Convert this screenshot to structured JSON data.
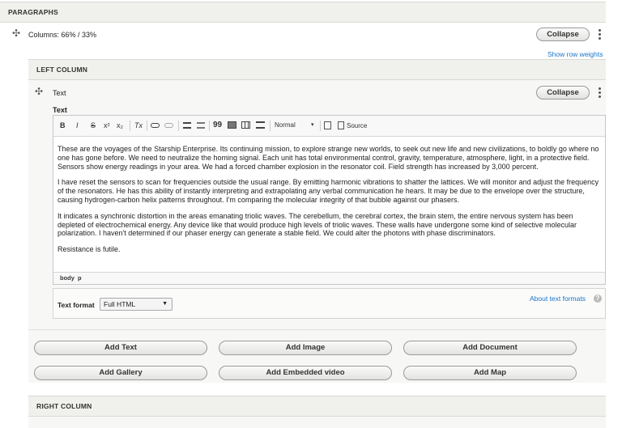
{
  "paragraphs_header": "PARAGRAPHS",
  "columns_row": {
    "label": "Columns: 66% / 33%",
    "collapse_label": "Collapse",
    "show_row_weights": "Show row weights"
  },
  "left_column": {
    "header": "LEFT COLUMN",
    "text_item": {
      "label": "Text",
      "collapse_label": "Collapse",
      "field_label": "Text"
    }
  },
  "toolbar": {
    "bold": "B",
    "italic": "I",
    "strike": "S",
    "superscript": "x²",
    "subscript": "x₂",
    "remove_format": "Tx",
    "blockquote": "99",
    "format_value": "Normal",
    "source": "Source"
  },
  "editor": {
    "paragraphs": [
      "These are the voyages of the Starship Enterprise. Its continuing mission, to explore strange new worlds, to seek out new life and new civilizations, to boldly go where no one has gone before. We need to neutralize the homing signal. Each unit has total environmental control, gravity, temperature, atmosphere, light, in a protective field. Sensors show energy readings in your area. We had a forced chamber explosion in the resonator coil. Field strength has increased by 3,000 percent.",
      "I have reset the sensors to scan for frequencies outside the usual range. By emitting harmonic vibrations to shatter the lattices. We will monitor and adjust the frequency of the resonators. He has this ability of instantly interpreting and extrapolating any verbal communication he hears. It may be due to the envelope over the structure, causing hydrogen-carbon helix patterns throughout. I'm comparing the molecular integrity of that bubble against our phasers.",
      "It indicates a synchronic distortion in the areas emanating triolic waves. The cerebellum, the cerebral cortex, the brain stem,  the entire nervous system has been depleted of electrochemical energy. Any device like that would produce high levels of triolic waves. These walls have undergone some kind of selective molecular polarization. I haven't determined if our phaser energy can generate a stable field. We could alter the photons with phase discriminators.",
      "Resistance is futile."
    ],
    "path": [
      "body",
      "p"
    ]
  },
  "text_format": {
    "label": "Text format",
    "value": "Full HTML",
    "about_link": "About text formats"
  },
  "add_buttons": [
    "Add Text",
    "Add Image",
    "Add Document",
    "Add Gallery",
    "Add Embedded video",
    "Add Map"
  ],
  "right_column": {
    "header": "RIGHT COLUMN"
  },
  "icons": [
    "drag-handle-icon",
    "kebab-menu-icon",
    "link-icon",
    "unlink-icon",
    "bulleted-list-icon",
    "numbered-list-icon",
    "image-icon",
    "table-icon",
    "horizontal-rule-icon",
    "dropdown-arrow-icon",
    "paste-icon",
    "source-icon",
    "help-icon"
  ]
}
